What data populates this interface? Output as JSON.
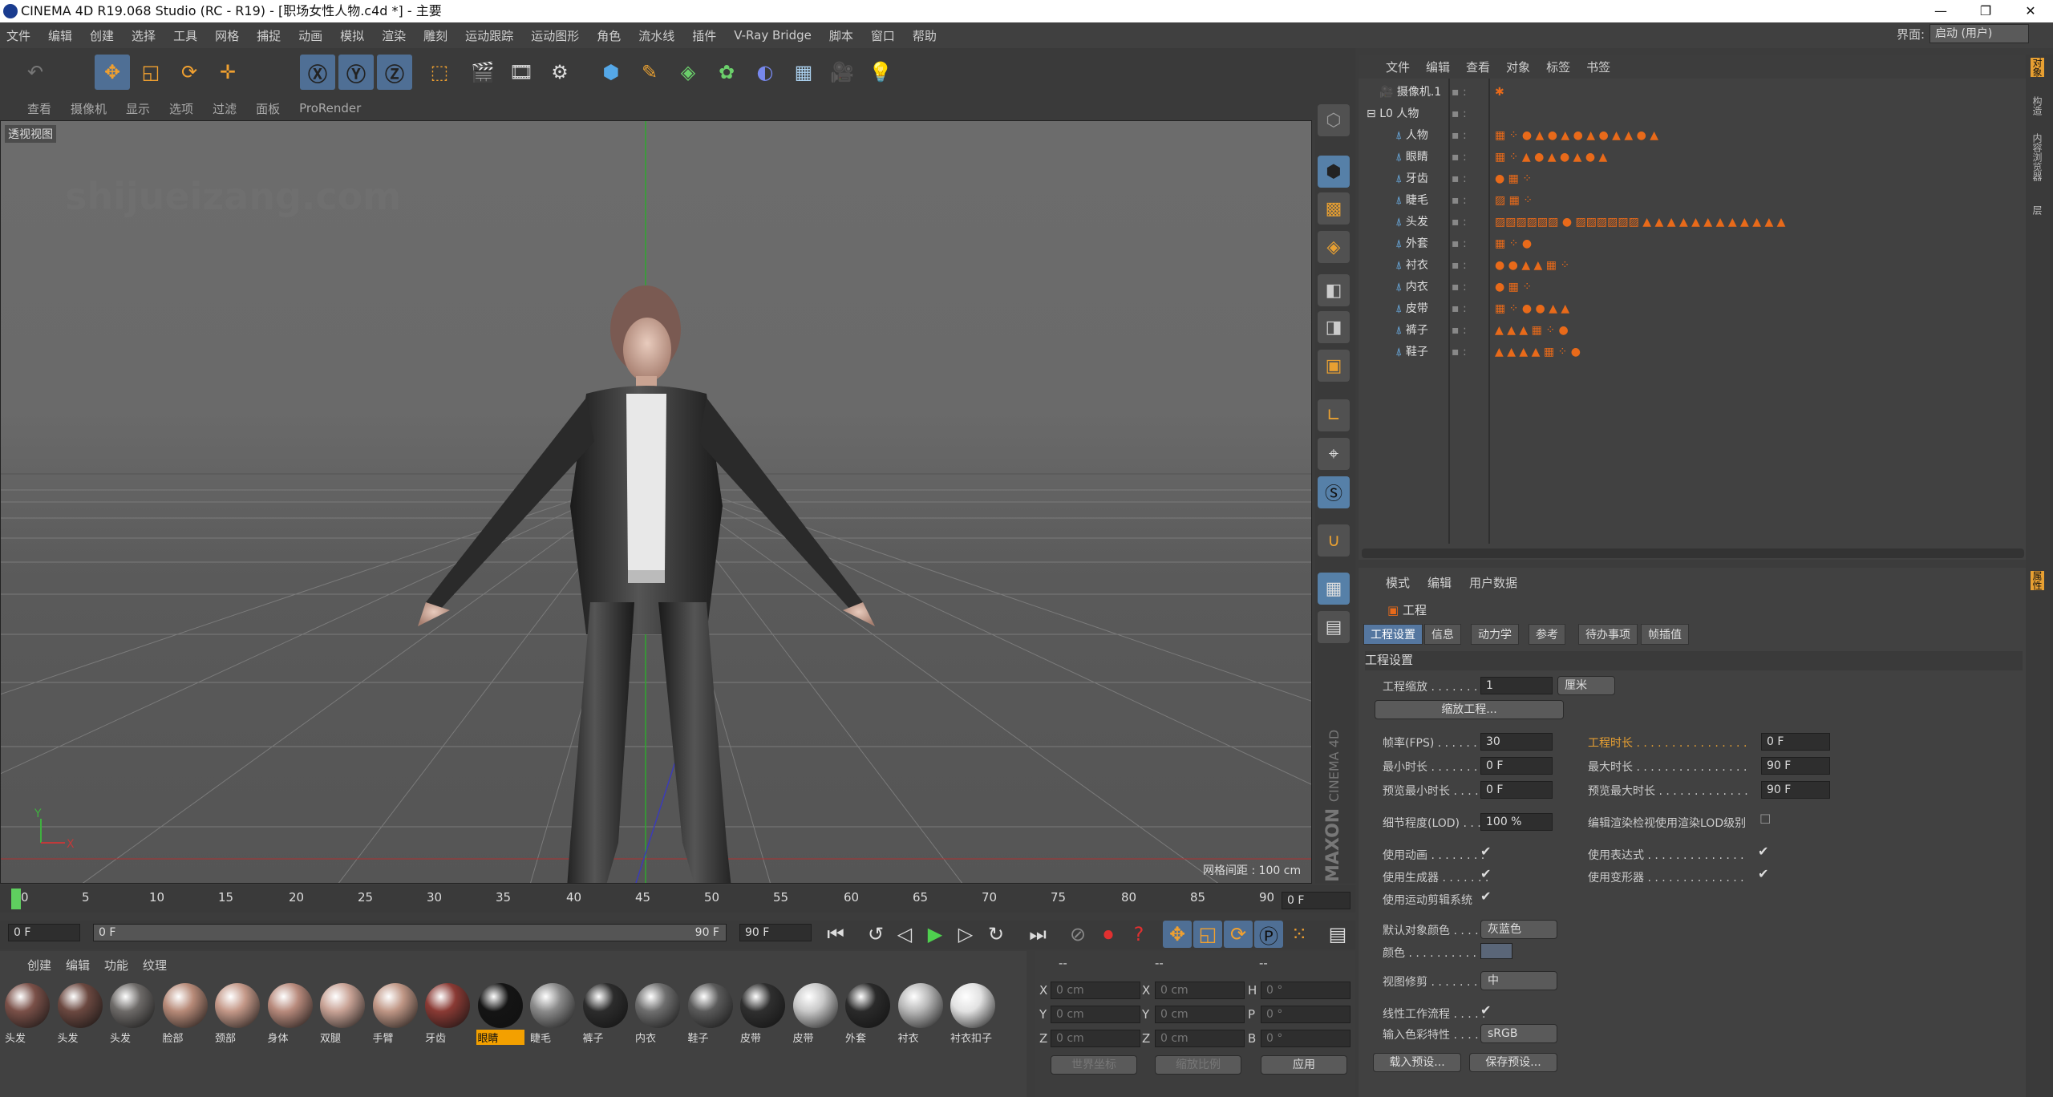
{
  "window": {
    "title": "CINEMA 4D R19.068 Studio (RC - R19) - [职场女性人物.c4d *] - 主要",
    "controls": [
      "—",
      "❐",
      "✕"
    ]
  },
  "menu": [
    "文件",
    "编辑",
    "创建",
    "选择",
    "工具",
    "网格",
    "捕捉",
    "动画",
    "模拟",
    "渲染",
    "雕刻",
    "运动跟踪",
    "运动图形",
    "角色",
    "流水线",
    "插件",
    "V-Ray Bridge",
    "脚本",
    "窗口",
    "帮助"
  ],
  "interface": {
    "label": "界面:",
    "value": "启动 (用户)"
  },
  "viewport": {
    "menu": [
      "查看",
      "摄像机",
      "显示",
      "选项",
      "过滤",
      "面板",
      "ProRender"
    ],
    "title": "透视视图",
    "grid_distance": "网格间距 : 100 cm",
    "watermark": "shijueizang.com",
    "axis_y": "Y",
    "axis_x": "X"
  },
  "maxon": {
    "brand": "MAXON",
    "product": "CINEMA 4D"
  },
  "objects": {
    "menu": [
      "文件",
      "编辑",
      "查看",
      "对象",
      "标签",
      "书签"
    ],
    "items": [
      {
        "name": "摄像机.1",
        "level": 0
      },
      {
        "name": "人物",
        "level": 0
      },
      {
        "name": "人物",
        "level": 1
      },
      {
        "name": "眼睛",
        "level": 1
      },
      {
        "name": "牙齿",
        "level": 1
      },
      {
        "name": "睫毛",
        "level": 1
      },
      {
        "name": "头发",
        "level": 1
      },
      {
        "name": "外套",
        "level": 1
      },
      {
        "name": "衬衣",
        "level": 1
      },
      {
        "name": "内衣",
        "level": 1
      },
      {
        "name": "皮带",
        "level": 1
      },
      {
        "name": "裤子",
        "level": 1
      },
      {
        "name": "鞋子",
        "level": 1
      }
    ]
  },
  "attributes": {
    "menu": [
      "模式",
      "编辑",
      "用户数据"
    ],
    "object": "工程",
    "tabs": [
      "工程设置",
      "信息",
      "动力学",
      "参考",
      "待办事项",
      "帧插值"
    ],
    "section": "工程设置",
    "project_scale_label": "工程缩放 . . . . . . . .",
    "project_scale_value": "1",
    "project_scale_unit": "厘米",
    "scale_button": "缩放工程...",
    "fps_label": "帧率(FPS) . . . . . . .",
    "fps_value": "30",
    "duration_label": "工程时长 . . . . . . . . . . . . . . . .",
    "duration_value": "0 F",
    "min_time_label": "最小时长 . . . . . . . .",
    "min_time_value": "0 F",
    "max_time_label": "最大时长 . . . . . . . . . . . . . . . .",
    "max_time_value": "90 F",
    "preview_min_label": "预览最小时长 . . . . .",
    "preview_min_value": "0 F",
    "preview_max_label": "预览最大时长 . . . . . . . . . . . . .",
    "preview_max_value": "90 F",
    "lod_label": "细节程度(LOD) . . . .",
    "lod_value": "100 %",
    "lod_render_label": "编辑渲染检视使用渲染LOD级别",
    "use_animation": "使用动画 . . . . . . . .",
    "use_expression": "使用表达式 . . . . . . . . . . . . . .",
    "use_generators": "使用生成器 . . . . . . .",
    "use_deformers": "使用变形器 . . . . . . . . . . . . . .",
    "use_motion": "使用运动剪辑系统",
    "default_color_label": "默认对象颜色 . . . . .",
    "default_color_value": "灰蓝色",
    "color_label": "颜色 . . . . . . . . . . .",
    "view_clip_label": "视图修剪 . . . . . . . .",
    "view_clip_value": "中",
    "linear_workflow": "线性工作流程 . . . . .",
    "input_color_label": "输入色彩特性 . . . . .",
    "input_color_value": "sRGB",
    "load_preset": "载入预设...",
    "save_preset": "保存预设...",
    "default_color_swatch": "#5a6678"
  },
  "timeline": {
    "ticks": [
      "0",
      "5",
      "10",
      "15",
      "20",
      "25",
      "30",
      "35",
      "40",
      "45",
      "50",
      "55",
      "60",
      "65",
      "70",
      "75",
      "80",
      "85",
      "90"
    ],
    "current": "0 F",
    "start": "0 F",
    "range_start": "0 F",
    "range_end": "90 F",
    "end": "90 F"
  },
  "materials": {
    "menu": [
      "创建",
      "编辑",
      "功能",
      "纹理"
    ],
    "items": [
      {
        "name": "头发",
        "color": "#7a5048"
      },
      {
        "name": "头发",
        "color": "#6b4840"
      },
      {
        "name": "头发",
        "color": "#6d6a68"
      },
      {
        "name": "脸部",
        "color": "#b78a78"
      },
      {
        "name": "颈部",
        "color": "#c49888"
      },
      {
        "name": "身体",
        "color": "#b88a7c"
      },
      {
        "name": "双腿",
        "color": "#c8a295"
      },
      {
        "name": "手臂",
        "color": "#bf9685"
      },
      {
        "name": "牙齿",
        "color": "#8a3a34"
      },
      {
        "name": "眼睛",
        "color": "#141414"
      },
      {
        "name": "睫毛",
        "color": "#8a8a8a"
      },
      {
        "name": "裤子",
        "color": "#2c2c2c"
      },
      {
        "name": "内衣",
        "color": "#6e6e6e"
      },
      {
        "name": "鞋子",
        "color": "#5a5a5a"
      },
      {
        "name": "皮带",
        "color": "#2f2f2f"
      },
      {
        "name": "皮带",
        "color": "#c8c8c8"
      },
      {
        "name": "外套",
        "color": "#2a2a2a"
      },
      {
        "name": "衬衣",
        "color": "#b8b8b8"
      },
      {
        "name": "衬衣扣子",
        "color": "#e2e2e2"
      }
    ],
    "selected_index": 9
  },
  "coordinates": {
    "headers": [
      "--",
      "--",
      "--"
    ],
    "rows": [
      {
        "a": "X",
        "av": "0 cm",
        "b": "X",
        "bv": "0 cm",
        "c": "H",
        "cv": "0 °"
      },
      {
        "a": "Y",
        "av": "0 cm",
        "b": "Y",
        "bv": "0 cm",
        "c": "P",
        "cv": "0 °"
      },
      {
        "a": "Z",
        "av": "0 cm",
        "b": "Z",
        "bv": "0 cm",
        "c": "B",
        "cv": "0 °"
      }
    ],
    "world": "世界坐标",
    "scale": "缩放比例",
    "apply": "应用"
  },
  "side_tabs": [
    "对象",
    "构造",
    "内容浏览器",
    "层",
    "属性"
  ]
}
